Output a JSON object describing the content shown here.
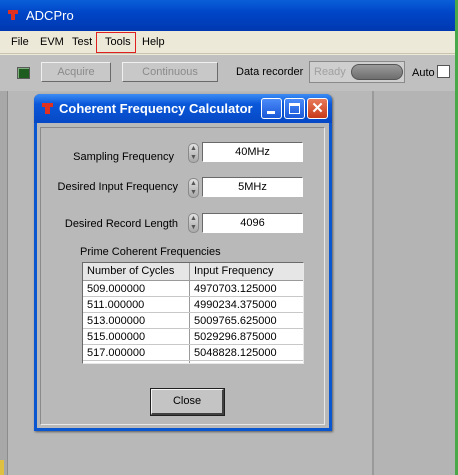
{
  "app": {
    "title": "ADCPro"
  },
  "menu": {
    "file": "File",
    "evm": "EVM",
    "test": "Test",
    "tools": "Tools",
    "help": "Help"
  },
  "toolbar": {
    "acquire_label": "Acquire",
    "continuous_label": "Continuous",
    "data_recorder_label": "Data recorder",
    "ready_status": "Ready",
    "auto_label": "Auto",
    "auto_checked": false
  },
  "dialog": {
    "title": "Coherent Frequency Calculator",
    "fields": {
      "sampling_frequency": {
        "label": "Sampling Frequency",
        "value": "40MHz"
      },
      "desired_input_frequency": {
        "label": "Desired Input Frequency",
        "value": "5MHz"
      },
      "desired_record_length": {
        "label": "Desired Record Length",
        "value": "4096"
      }
    },
    "table": {
      "caption": "Prime Coherent Frequencies",
      "columns": [
        "Number of Cycles",
        "Input Frequency"
      ],
      "rows": [
        [
          "509.000000",
          "4970703.125000"
        ],
        [
          "511.000000",
          "4990234.375000"
        ],
        [
          "513.000000",
          "5009765.625000"
        ],
        [
          "515.000000",
          "5029296.875000"
        ],
        [
          "517.000000",
          "5048828.125000"
        ]
      ]
    },
    "close_label": "Close"
  },
  "colors": {
    "titlebar": "#0046c8",
    "panel": "#b9b9b9",
    "highlight": "#e02020"
  }
}
